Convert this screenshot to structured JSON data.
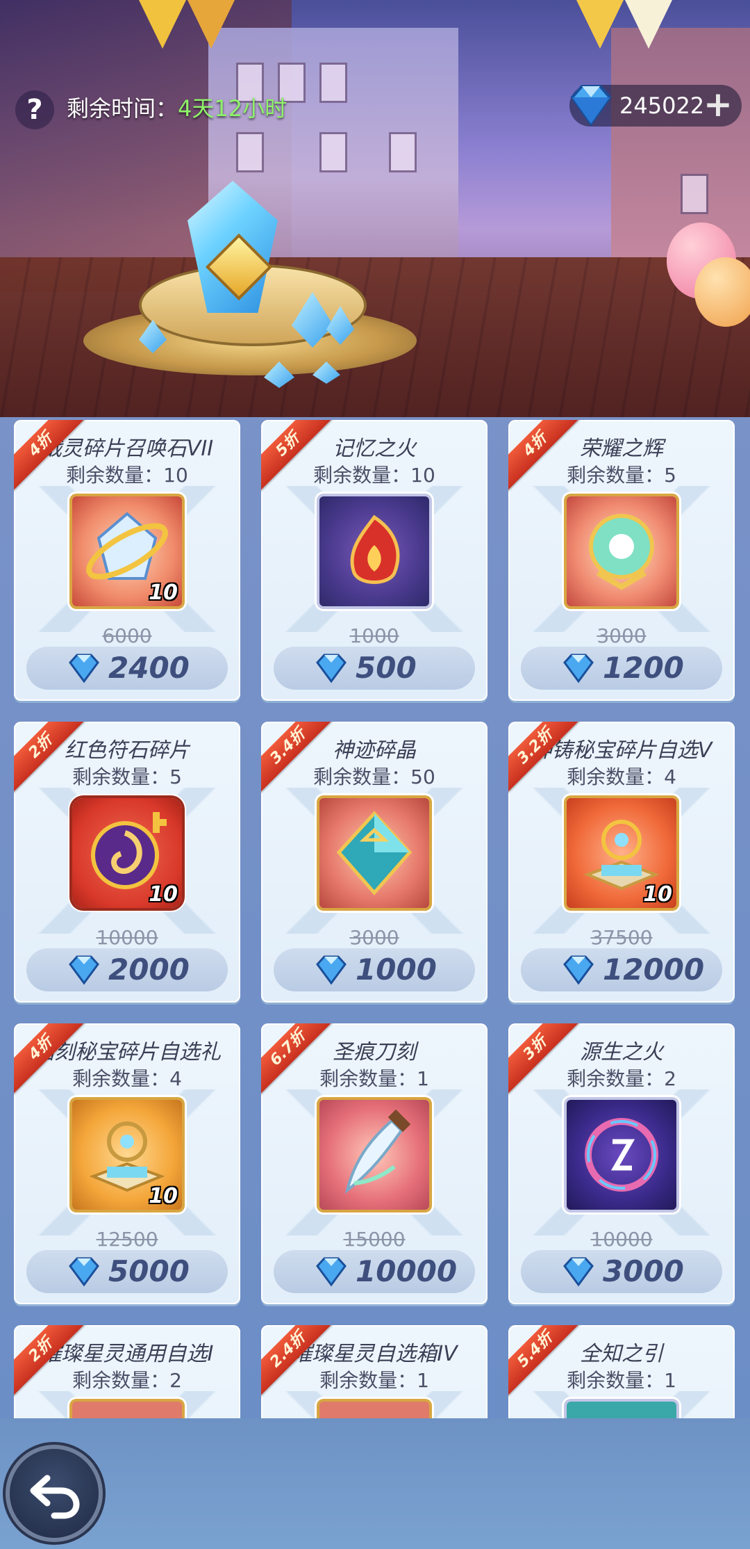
{
  "header": {
    "timer_label": "剩余时间：",
    "timer_value": "4天12小时",
    "currency_amount": "245022",
    "help_icon": "question-icon",
    "add_icon": "plus-icon",
    "currency_icon": "diamond-icon"
  },
  "items": [
    {
      "discount": "4折",
      "name": "战灵碎片召唤石VII",
      "stock": "剩余数量：10",
      "qty": "10",
      "original": "6000",
      "price": "2400",
      "icon": "summon-stone-icon"
    },
    {
      "discount": "5折",
      "name": "记忆之火",
      "stock": "剩余数量：10",
      "qty": "",
      "original": "1000",
      "price": "500",
      "icon": "memory-flame-icon"
    },
    {
      "discount": "4折",
      "name": "荣耀之辉",
      "stock": "剩余数量：5",
      "qty": "",
      "original": "3000",
      "price": "1200",
      "icon": "glory-orb-icon"
    },
    {
      "discount": "2折",
      "name": "红色符石碎片",
      "stock": "剩余数量：5",
      "qty": "10",
      "original": "10000",
      "price": "2000",
      "icon": "red-rune-icon"
    },
    {
      "discount": "3.4折",
      "name": "神迹碎晶",
      "stock": "剩余数量：50",
      "qty": "",
      "original": "3000",
      "price": "1000",
      "icon": "miracle-crystal-icon"
    },
    {
      "discount": "3.2折",
      "name": "神铸秘宝碎片自选V",
      "stock": "剩余数量：4",
      "qty": "10",
      "original": "37500",
      "price": "12000",
      "icon": "divine-treasure-icon"
    },
    {
      "discount": "4折",
      "name": "铭刻秘宝碎片自选礼",
      "stock": "剩余数量：4",
      "qty": "10",
      "original": "12500",
      "price": "5000",
      "icon": "engraved-treasure-icon"
    },
    {
      "discount": "6.7折",
      "name": "圣痕刀刻",
      "stock": "剩余数量：1",
      "qty": "",
      "original": "15000",
      "price": "10000",
      "icon": "stigma-blade-icon"
    },
    {
      "discount": "3折",
      "name": "源生之火",
      "stock": "剩余数量：2",
      "qty": "",
      "original": "10000",
      "price": "3000",
      "icon": "origin-flame-icon"
    },
    {
      "discount": "2折",
      "name": "璀璨星灵通用自选I",
      "stock": "剩余数量：2",
      "qty": "",
      "original": "",
      "price": "",
      "icon": "star-spirit-icon"
    },
    {
      "discount": "2.4折",
      "name": "璀璨星灵自选箱IV",
      "stock": "剩余数量：1",
      "qty": "",
      "original": "",
      "price": "",
      "icon": "star-spirit-box-icon"
    },
    {
      "discount": "5.4折",
      "name": "全知之引",
      "stock": "剩余数量：1",
      "qty": "",
      "original": "",
      "price": "",
      "icon": "omniscience-icon"
    }
  ],
  "footer": {
    "back_icon": "back-arrow-icon"
  }
}
